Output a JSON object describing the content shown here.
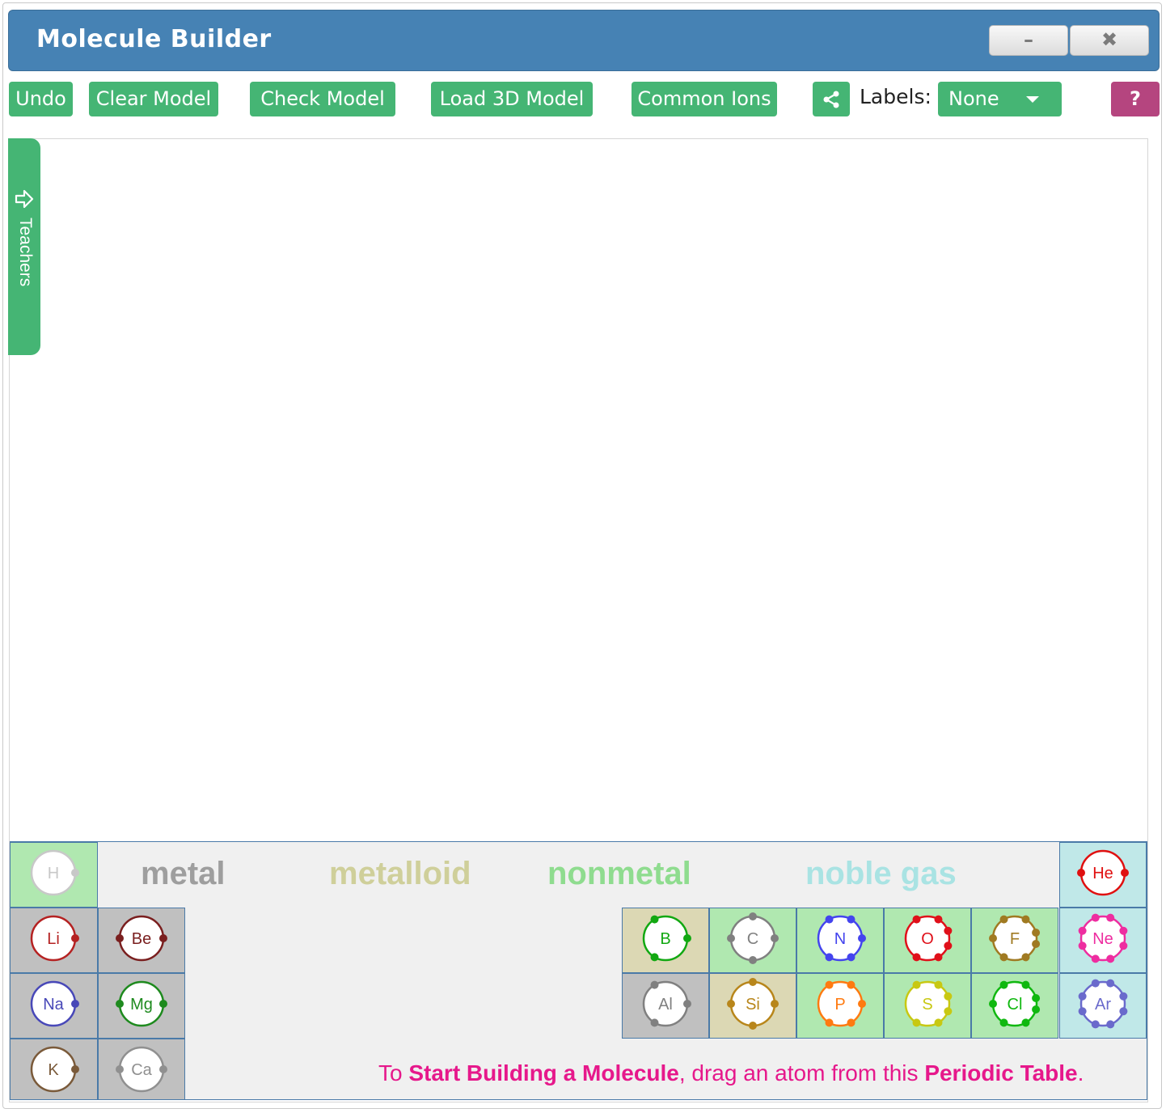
{
  "window": {
    "title": "Molecule Builder",
    "minimize_label": "–",
    "close_label": "✖",
    "title_color": "#4682b4"
  },
  "toolbar": {
    "undo": "Undo",
    "clear": "Clear Model",
    "check": "Check Model",
    "load3d": "Load 3D Model",
    "ions": "Common Ions",
    "share_icon": "share-icon",
    "labels_label": "Labels:",
    "labels_value": "None",
    "help": "?",
    "button_color": "#45b574",
    "help_color": "#b5457f"
  },
  "side_tab": {
    "label": "Teachers",
    "icon": "arrow-right-outline-icon"
  },
  "legend": {
    "metal": "metal",
    "metalloid": "metalloid",
    "nonmetal": "nonmetal",
    "noble_gas": "noble gas",
    "colors": {
      "metal": "#9e9e9e",
      "metalloid": "#cfcf9a",
      "nonmetal": "#8fdc8f",
      "noble_gas": "#a9e3e3"
    }
  },
  "elements": [
    {
      "symbol": "H",
      "group": "nonmetal",
      "color": "#c8c8c8",
      "electrons": 1
    },
    {
      "symbol": "He",
      "group": "noble_gas",
      "color": "#e01010",
      "electrons": 2
    },
    {
      "symbol": "Li",
      "group": "metal",
      "color": "#b52222",
      "electrons": 1
    },
    {
      "symbol": "Be",
      "group": "metal",
      "color": "#7a1f1f",
      "electrons": 2
    },
    {
      "symbol": "B",
      "group": "metalloid",
      "color": "#12a812",
      "electrons": 3
    },
    {
      "symbol": "C",
      "group": "nonmetal",
      "color": "#808080",
      "electrons": 4
    },
    {
      "symbol": "N",
      "group": "nonmetal",
      "color": "#4444ee",
      "electrons": 5
    },
    {
      "symbol": "O",
      "group": "nonmetal",
      "color": "#e0101a",
      "electrons": 6
    },
    {
      "symbol": "F",
      "group": "nonmetal",
      "color": "#a07a22",
      "electrons": 7
    },
    {
      "symbol": "Ne",
      "group": "noble_gas",
      "color": "#ee2da0",
      "electrons": 8
    },
    {
      "symbol": "Na",
      "group": "metal",
      "color": "#4848b8",
      "electrons": 1
    },
    {
      "symbol": "Mg",
      "group": "metal",
      "color": "#1e8a1e",
      "electrons": 2
    },
    {
      "symbol": "Al",
      "group": "metal",
      "color": "#808080",
      "electrons": 3
    },
    {
      "symbol": "Si",
      "group": "metalloid",
      "color": "#b8861b",
      "electrons": 4
    },
    {
      "symbol": "P",
      "group": "nonmetal",
      "color": "#ff7a10",
      "electrons": 5
    },
    {
      "symbol": "S",
      "group": "nonmetal",
      "color": "#c8c812",
      "electrons": 6
    },
    {
      "symbol": "Cl",
      "group": "nonmetal",
      "color": "#10b810",
      "electrons": 7
    },
    {
      "symbol": "Ar",
      "group": "noble_gas",
      "color": "#6a6acc",
      "electrons": 8
    },
    {
      "symbol": "K",
      "group": "metal",
      "color": "#7a5a3a",
      "electrons": 1
    },
    {
      "symbol": "Ca",
      "group": "metal",
      "color": "#909090",
      "electrons": 2
    }
  ],
  "instruction": {
    "part1": "To ",
    "part2": "Start Building a Molecule",
    "part3": ", drag an atom from this ",
    "part4": "Periodic Table",
    "part5": "."
  }
}
